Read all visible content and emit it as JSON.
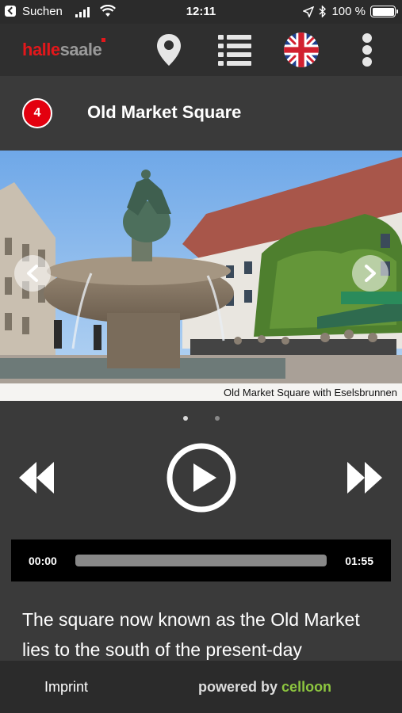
{
  "status_bar": {
    "carrier": "Suchen",
    "time": "12:11",
    "battery": "100 %"
  },
  "app_bar": {
    "logo_part1": "halle",
    "logo_part2": "saale",
    "icons": [
      "map-pin-icon",
      "list-icon",
      "uk-flag-icon",
      "more-vertical-icon"
    ]
  },
  "station": {
    "number": "4",
    "title": "Old Market Square"
  },
  "gallery": {
    "caption": "Old Market Square with Eselsbrunnen",
    "slide_count": 2,
    "active_slide": 1
  },
  "player": {
    "current_time": "00:00",
    "duration": "01:55",
    "progress_fraction": 0
  },
  "description": "The square now known as the Old Market lies to the south of the present-day",
  "footer": {
    "imprint": "Imprint",
    "powered_by": "powered by",
    "brand": "celloon"
  },
  "colors": {
    "accent_red": "#e3000f",
    "brand_green": "#8dc63f",
    "background": "#3a3a3a"
  }
}
